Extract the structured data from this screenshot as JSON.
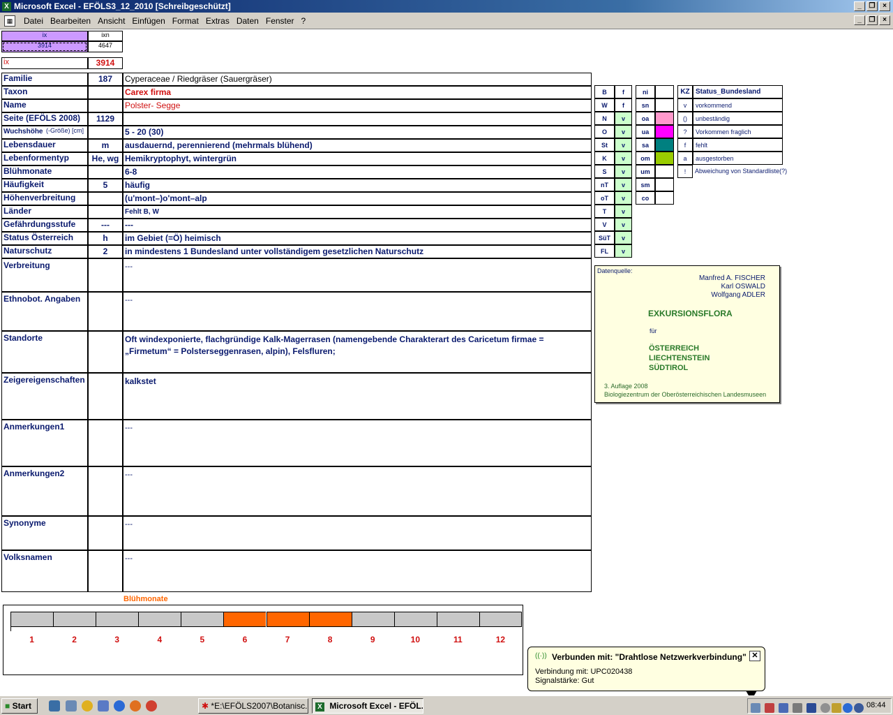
{
  "window": {
    "title": "Microsoft Excel - EFÖLS3_12_2010  [Schreibgeschützt]"
  },
  "menu": [
    "Datei",
    "Bearbeiten",
    "Ansicht",
    "Einfügen",
    "Format",
    "Extras",
    "Daten",
    "Fenster",
    "?"
  ],
  "header_cells": {
    "ix_label": "ix",
    "ixn_label": "ixn",
    "ix_value": "3914",
    "ixn_value": "4647",
    "ix_row_label": "ix",
    "ix_row_value": "3914"
  },
  "rows": [
    {
      "label": "Familie",
      "num": "187",
      "value": "Cyperaceae  /  Riedgräser (Sauergräser)"
    },
    {
      "label": "Taxon",
      "num": "",
      "value": "Carex firma"
    },
    {
      "label": "Name",
      "num": "",
      "value": "Polster- Segge"
    },
    {
      "label": "Seite (EFÖLS 2008)",
      "num": "1129",
      "value": ""
    },
    {
      "label": "Wuchshöhe",
      "label_suffix": "(-Größe) [cm]",
      "num": "",
      "value": " 5 - 20 (30)"
    },
    {
      "label": "Lebensdauer",
      "num": "m",
      "value": "ausdauernd, perennierend (mehrmals blühend)"
    },
    {
      "label": "Lebenformentyp",
      "num": "He, wg",
      "value": "Hemikryptophyt, wintergrün"
    },
    {
      "label": "Blühmonate",
      "num": "",
      "value": " 6-8"
    },
    {
      "label": "Häufigkeit",
      "num": "5",
      "value": "häufig"
    },
    {
      "label": "Höhenverbreitung",
      "num": "",
      "value": "(u'mont–)o'mont–alp"
    },
    {
      "label": "Länder",
      "num": "",
      "value": "Fehlt B, W"
    },
    {
      "label": "Gefährdungsstufe",
      "num": "---",
      "value": "  ---"
    },
    {
      "label": "Status Österreich",
      "num": "h",
      "value": "im Gebiet (=Ö) heimisch"
    },
    {
      "label": "Naturschutz",
      "num": "2",
      "value": "in mindestens 1 Bundesland unter vollständigem gesetzlichen Naturschutz"
    }
  ],
  "big_rows": [
    {
      "label": "Verbreitung",
      "value": " ---"
    },
    {
      "label": "Ethnobot. Angaben",
      "value": "---"
    },
    {
      "label": "Standorte",
      "value": "Oft windexponierte, flachgründige Kalk-Magerrasen (namengebende Charakterart des Caricetum firmae =",
      "value2": "„Firmetum“ = Polsterseggenrasen, alpin), Felsfluren;"
    },
    {
      "label": "Zeigereigenschaften",
      "value": "kalkstet"
    },
    {
      "label": "Anmerkungen1",
      "value": "---"
    },
    {
      "label": "Anmerkungen2",
      "value": "---"
    },
    {
      "label": "Synonyme",
      "value": "---"
    },
    {
      "label": "Volksnamen",
      "value": "---"
    }
  ],
  "region_table": [
    {
      "code": "B",
      "val": "f"
    },
    {
      "code": "W",
      "val": "f"
    },
    {
      "code": "N",
      "val": "v"
    },
    {
      "code": "O",
      "val": "v"
    },
    {
      "code": "St",
      "val": "v"
    },
    {
      "code": "K",
      "val": "v"
    },
    {
      "code": "S",
      "val": "v"
    },
    {
      "code": "nT",
      "val": "v"
    },
    {
      "code": "oT",
      "val": "v"
    },
    {
      "code": "T",
      "val": "v"
    },
    {
      "code": "V",
      "val": "v"
    },
    {
      "code": "SüT",
      "val": "v"
    },
    {
      "code": "FL",
      "val": "v"
    }
  ],
  "zone_table": [
    {
      "code": "ni",
      "color": ""
    },
    {
      "code": "sn",
      "color": ""
    },
    {
      "code": "oa",
      "color": "#ff99cc"
    },
    {
      "code": "ua",
      "color": "#ff00ff"
    },
    {
      "code": "sa",
      "color": "#008080"
    },
    {
      "code": "om",
      "color": "#99cc00"
    },
    {
      "code": "um",
      "color": ""
    },
    {
      "code": "sm",
      "color": ""
    },
    {
      "code": "co",
      "color": ""
    }
  ],
  "status_legend": {
    "header_kz": "KZ",
    "header_title": "Status_Bundesland",
    "items": [
      {
        "kz": "v",
        "text": "vorkommend"
      },
      {
        "kz": "()",
        "text": "unbeständig"
      },
      {
        "kz": "?",
        "text": "Vorkommen fraglich"
      },
      {
        "kz": "f",
        "text": "fehlt"
      },
      {
        "kz": "a",
        "text": "ausgestorben"
      },
      {
        "kz": "!",
        "text": "Abweichung von Standardliste(?)"
      }
    ]
  },
  "source_box": {
    "label": "Datenquelle:",
    "authors": [
      "Manfred A. FISCHER",
      "Karl OSWALD",
      "Wolfgang ADLER"
    ],
    "title": "EXKURSIONSFLORA",
    "fuer": "für",
    "countries": [
      "ÖSTERREICH",
      "LIECHTENSTEIN",
      "SÜDTIROL"
    ],
    "edition": "3. Auflage 2008",
    "publisher": "Biologiezentrum der Oberösterreichischen Landesmuseen"
  },
  "bloom_chart": {
    "title": "Blühmonate",
    "months": [
      "1",
      "2",
      "3",
      "4",
      "5",
      "6",
      "7",
      "8",
      "9",
      "10",
      "11",
      "12"
    ],
    "active": [
      false,
      false,
      false,
      false,
      false,
      true,
      true,
      true,
      false,
      false,
      false,
      false
    ],
    "active_color": "#ff6600",
    "inactive_color": "#c8c8c8"
  },
  "notification": {
    "title": "Verbunden mit: \"Drahtlose Netzwerkverbindung\"",
    "line1": "Verbindung mit: UPC020438",
    "line2": "Signalstärke: Gut"
  },
  "taskbar": {
    "start": "Start",
    "task1": "*E:\\EFÖLS2007\\Botanisc...",
    "task2": "Microsoft Excel - EFÖL...",
    "clock": "08:44"
  }
}
